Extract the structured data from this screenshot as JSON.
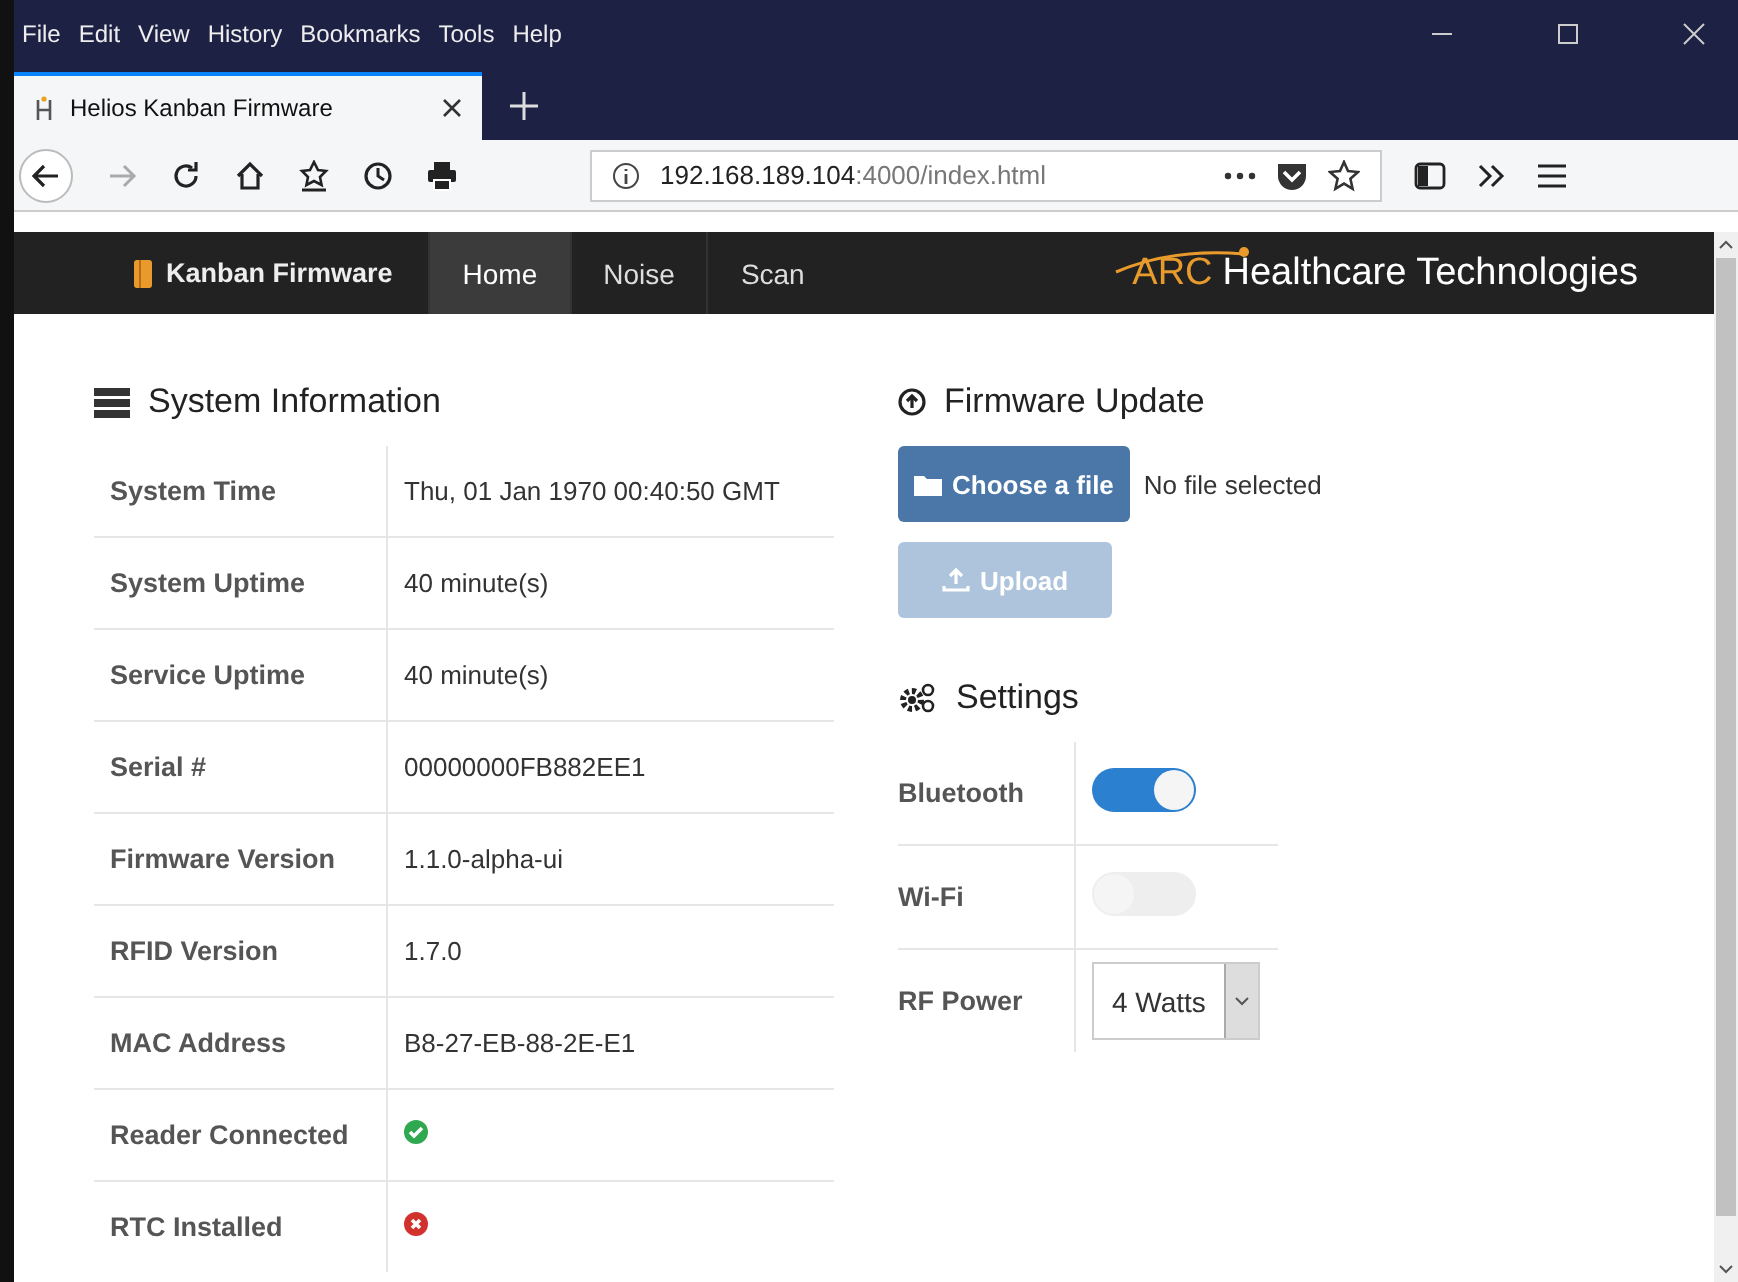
{
  "menu_bar": [
    "File",
    "Edit",
    "View",
    "History",
    "Bookmarks",
    "Tools",
    "Help"
  ],
  "tabs": [
    {
      "title": "Helios Kanban Firmware",
      "selected": true
    }
  ],
  "address_bar": {
    "host": "192.168.189.104",
    "path": ":4000/index.html"
  },
  "navbar": {
    "brand": "Kanban Firmware",
    "items": [
      {
        "label": "Home",
        "selected": true
      },
      {
        "label": "Noise",
        "selected": false
      },
      {
        "label": "Scan",
        "selected": false
      }
    ],
    "logo_mark": "ARC",
    "logo_text": "Healthcare Technologies"
  },
  "system_information": {
    "title": "System Information",
    "rows": [
      {
        "label": "System Time",
        "kind": "text",
        "value": "Thu, 01 Jan 1970 00:40:50 GMT"
      },
      {
        "label": "System Uptime",
        "kind": "text",
        "value": "40 minute(s)"
      },
      {
        "label": "Service Uptime",
        "kind": "text",
        "value": "40 minute(s)"
      },
      {
        "label": "Serial #",
        "kind": "text",
        "value": "00000000FB882EE1"
      },
      {
        "label": "Firmware Version",
        "kind": "text",
        "value": "1.1.0-alpha-ui"
      },
      {
        "label": "RFID Version",
        "kind": "text",
        "value": "1.7.0"
      },
      {
        "label": "MAC Address",
        "kind": "text",
        "value": "B8-27-EB-88-2E-E1"
      },
      {
        "label": "Reader Connected",
        "kind": "status",
        "ok": true
      },
      {
        "label": "RTC Installed",
        "kind": "status",
        "ok": false
      }
    ]
  },
  "firmware_update": {
    "title": "Firmware Update",
    "choose_button": "Choose a file",
    "file_status": "No file selected",
    "upload_button": {
      "label": "Upload",
      "disabled": true
    }
  },
  "settings": {
    "title": "Settings",
    "rows": [
      {
        "label": "Bluetooth",
        "kind": "toggle",
        "on": true
      },
      {
        "label": "Wi-Fi",
        "kind": "toggle",
        "on": false
      },
      {
        "label": "RF Power",
        "kind": "select",
        "value": "4 Watts"
      }
    ]
  }
}
